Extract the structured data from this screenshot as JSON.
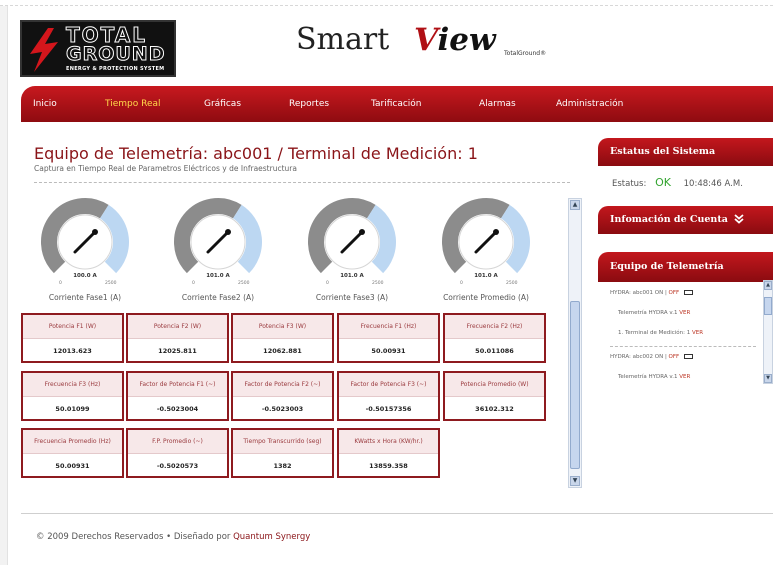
{
  "logo": {
    "line1": "TOTAL",
    "line2": "GROUND",
    "tagline": "ENERGY & PROTECTION SYSTEM"
  },
  "brand": {
    "smart": "Smart",
    "view": "View",
    "small": "TotalGround®"
  },
  "nav": {
    "items": [
      "Inicio",
      "Tiempo Real",
      "Gráficas",
      "Reportes",
      "Tarificación",
      "Alarmas",
      "Administración"
    ],
    "active": "Tiempo Real",
    "active_color": "#ffd84a"
  },
  "main": {
    "title": "Equipo de Telemetría: abc001 / Terminal de Medición: 1",
    "subtitle": "Captura en Tiempo Real de Parametros Eléctricos y de Infraestructura",
    "gauges": [
      {
        "label": "Corriente Fase1 (A)",
        "readout": "100.0 A",
        "value": 100.0,
        "min": "0",
        "max": "2500"
      },
      {
        "label": "Corriente Fase2 (A)",
        "readout": "101.0 A",
        "value": 101.0,
        "min": "0",
        "max": "2500"
      },
      {
        "label": "Corriente Fase3 (A)",
        "readout": "101.0 A",
        "value": 101.0,
        "min": "0",
        "max": "2500"
      },
      {
        "label": "Corriente Promedio (A)",
        "readout": "101.0 A",
        "value": 101.0,
        "min": "0",
        "max": "2500"
      }
    ],
    "cards": [
      {
        "label": "Potencia F1 (W)",
        "value": "12013.623"
      },
      {
        "label": "Potencia F2 (W)",
        "value": "12025.811"
      },
      {
        "label": "Potencia F3 (W)",
        "value": "12062.881"
      },
      {
        "label": "Frecuencia F1 (Hz)",
        "value": "50.00931"
      },
      {
        "label": "Frecuencia F2 (Hz)",
        "value": "50.011086"
      },
      {
        "label": "Frecuencia F3 (Hz)",
        "value": "50.01099"
      },
      {
        "label": "Factor de Potencia F1 (~)",
        "value": "-0.5023004"
      },
      {
        "label": "Factor de Potencia F2 (~)",
        "value": "-0.5023003"
      },
      {
        "label": "Factor de Potencia F3 (~)",
        "value": "-0.50157356"
      },
      {
        "label": "Potencia Promedio (W)",
        "value": "36102.312"
      },
      {
        "label": "Frecuencia Promedio (Hz)",
        "value": "50.00931"
      },
      {
        "label": "F.P. Promedio (~)",
        "value": "-0.5020573"
      },
      {
        "label": "Tiempo Transcurrido (seg)",
        "value": "1382"
      },
      {
        "label": "KWatts x Hora (KW/hr.)",
        "value": "13859.358"
      }
    ]
  },
  "sidebar": {
    "status_header": "Estatus del Sistema",
    "status_label": "Estatus:",
    "status_value": "OK",
    "status_time": "10:48:46 A.M.",
    "account_header": "Infomación de Cuenta",
    "account_icon": "double-chevron-down-icon",
    "telemetry_header": "Equipo de Telemetría",
    "telemetry": [
      {
        "device": "HYDRA: abc001",
        "on": "ON",
        "sep": "|",
        "off": "OFF",
        "sub1_text": "Telemetría HYDRA v.1",
        "sub1_link": "VER",
        "sub2_text": "1. Terminal de Medición: 1",
        "sub2_link": "VER"
      },
      {
        "device": "HYDRA: abc002",
        "on": "ON",
        "sep": "|",
        "off": "OFF",
        "sub1_text": "Telemetría HYDRA v.1",
        "sub1_link": "VER"
      }
    ]
  },
  "footer": {
    "copyright": "© 2009 Derechos Reservados",
    "bullet": "•",
    "designed": "Diseñado por",
    "designer": "Quantum Synergy"
  },
  "colors": {
    "accent": "#b01015",
    "nav_top": "#c8191f",
    "nav_bottom": "#8e0b10",
    "ok_green": "#34a430",
    "title_red": "#8a1418"
  }
}
